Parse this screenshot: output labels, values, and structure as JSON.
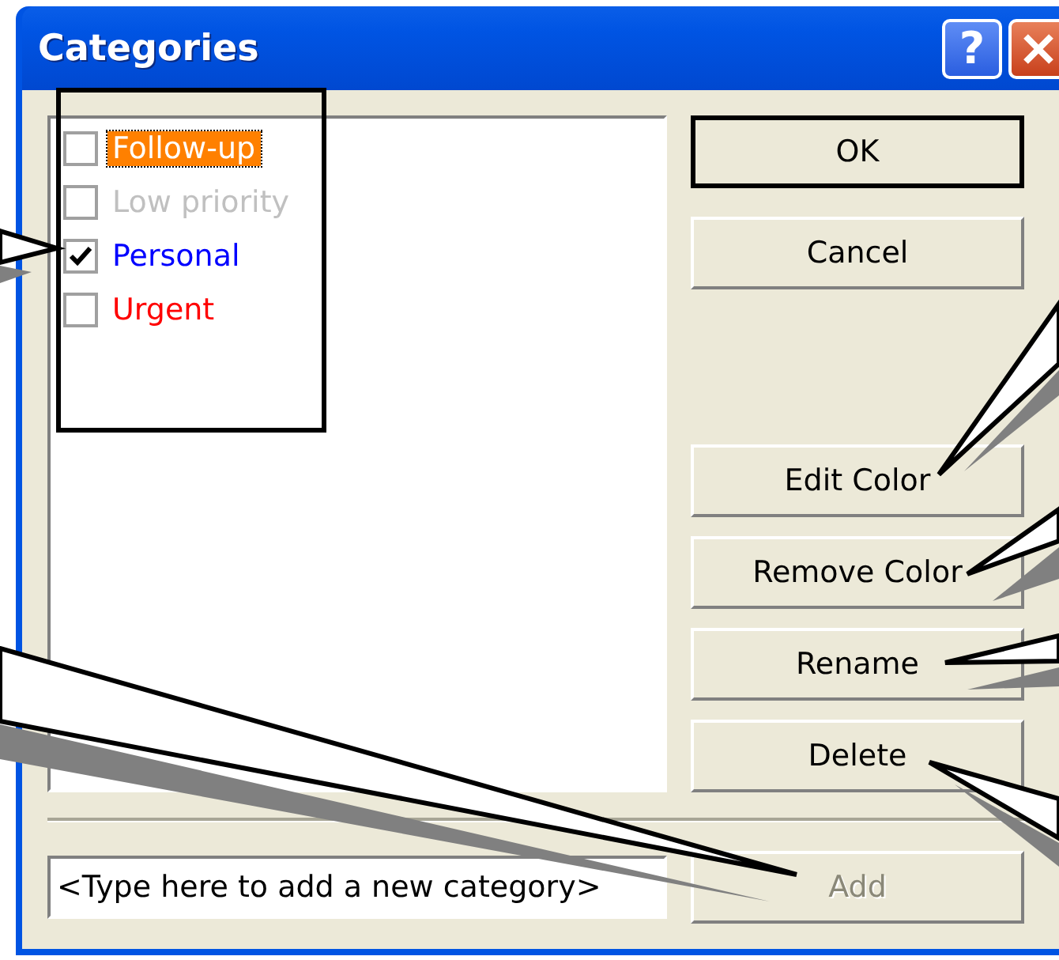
{
  "window": {
    "title": "Categories",
    "help_glyph": "?"
  },
  "categories": [
    {
      "label": "Follow-up",
      "checked": false,
      "selected": true,
      "color": "#ff8000"
    },
    {
      "label": "Low priority",
      "checked": false,
      "selected": false,
      "color": "#c0c0c0"
    },
    {
      "label": "Personal",
      "checked": true,
      "selected": false,
      "color": "#0000ff"
    },
    {
      "label": "Urgent",
      "checked": false,
      "selected": false,
      "color": "#ff0000"
    }
  ],
  "dialog_buttons": [
    {
      "label": "OK",
      "default": true
    },
    {
      "label": "Cancel",
      "default": false
    }
  ],
  "action_buttons": [
    {
      "label": "Edit Color",
      "disabled": false
    },
    {
      "label": "Remove Color",
      "disabled": false
    },
    {
      "label": "Rename",
      "disabled": false
    },
    {
      "label": "Delete",
      "disabled": false
    }
  ],
  "new_category": {
    "value": "<Type here to add a new category>"
  },
  "add_button": {
    "label": "Add",
    "disabled": true
  }
}
